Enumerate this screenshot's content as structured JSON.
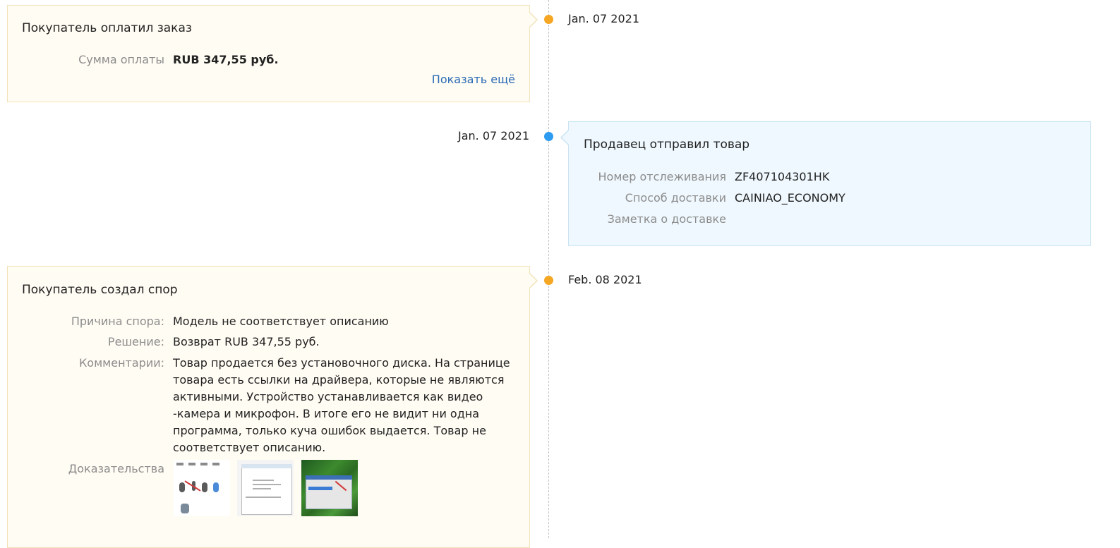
{
  "events": [
    {
      "date": "Jan. 07 2021",
      "title": "Покупатель оплатил заказ",
      "fields": [
        {
          "label": "Сумма оплаты",
          "value": "RUB 347,55 руб."
        }
      ],
      "show_more": "Показать ещё"
    },
    {
      "date": "Jan. 07 2021",
      "title": "Продавец отправил товар",
      "fields": [
        {
          "label": "Номер отслеживания",
          "value": "ZF407104301HK"
        },
        {
          "label": "Способ доставки",
          "value": "CAINIAO_ECONOMY"
        },
        {
          "label": "Заметка о доставке",
          "value": ""
        }
      ]
    },
    {
      "date": "Feb. 08 2021",
      "title": "Покупатель создал спор",
      "fields": [
        {
          "label": "Причина спора:",
          "value": "Модель не соответствует описанию"
        },
        {
          "label": "Решение:",
          "value": "Возврат RUB 347,55 руб."
        },
        {
          "label": "Комментарии:",
          "value": "Товар продается без установочного диска. На странице товара есть ссылки на драйвера, которые не являются активными. Устройство устанавливается как видео -камера и микрофон. В итоге его не видит ни одна программа, только куча ошибок выдается. Товар не соответствует описанию."
        }
      ],
      "evidence_label": "Доказательства",
      "evidence": [
        "evidence-image-1",
        "evidence-image-2",
        "evidence-image-3"
      ]
    }
  ],
  "colors": {
    "dot_buyer": "#f5a623",
    "dot_seller": "#2d9cf0",
    "card_buyer_bg": "#fffcf3",
    "card_seller_bg": "#eff8fe",
    "link": "#2a6ab5",
    "label": "#8c8c8c"
  }
}
